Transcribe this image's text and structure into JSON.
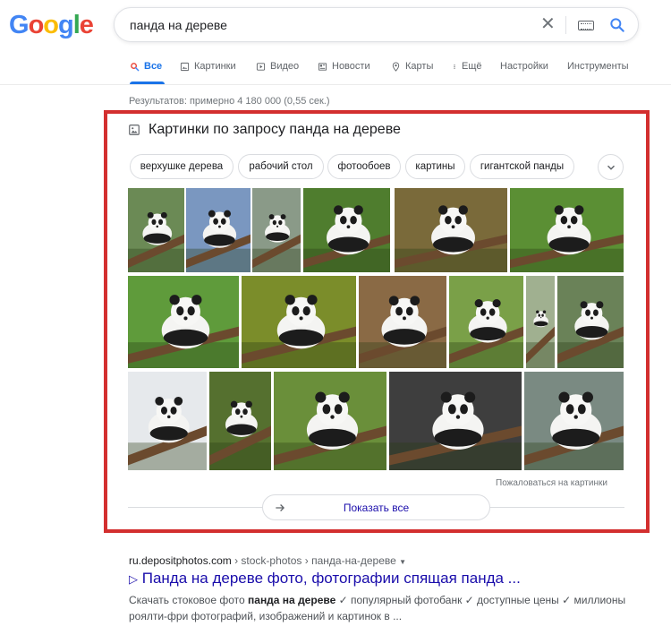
{
  "logo": {
    "letters": [
      "G",
      "o",
      "o",
      "g",
      "l",
      "e"
    ],
    "colors": [
      "#4285F4",
      "#EA4335",
      "#FBBC05",
      "#4285F4",
      "#34A853",
      "#EA4335"
    ]
  },
  "search": {
    "query": "панда на дереве",
    "clear_icon": "close-icon",
    "keyboard_icon": "keyboard-icon",
    "search_icon": "search-icon"
  },
  "tabs": [
    {
      "label": "Все",
      "icon": "search-icon",
      "active": true
    },
    {
      "label": "Картинки",
      "icon": "image-icon"
    },
    {
      "label": "Видео",
      "icon": "play-icon"
    },
    {
      "label": "Новости",
      "icon": "news-icon"
    },
    {
      "label": "Карты",
      "icon": "pin-icon"
    },
    {
      "label": "Ещё",
      "icon": "more-vert-icon"
    },
    {
      "label": "Настройки"
    },
    {
      "label": "Инструменты"
    }
  ],
  "stats": "Результатов: примерно 4 180 000 (0,55 сек.) ",
  "images_section": {
    "title": "Картинки по запросу панда на дереве",
    "chips": [
      "верхушке дерева",
      "рабочий стол",
      "фотообоев",
      "картины",
      "гигантской панды"
    ],
    "report": "Пожаловаться на картинки",
    "show_all": "Показать все"
  },
  "result": {
    "domain": "ru.depositphotos.com",
    "path": " › stock-photos › панда-на-дереве ",
    "title": "Панда на дереве фото, фотографии спящая панда ...",
    "snippet_pre": "Скачать стоковое фото ",
    "snippet_bold": "панда на дереве",
    "snippet_post": " ✓ популярный фотобанк ✓ доступные цены ✓ миллионы роялти-фри фотографий, изображений и картинок в ..."
  },
  "colors": {
    "accent": "#1a73e8",
    "link": "#1a0dab",
    "highlight_border": "#d32f2f"
  }
}
